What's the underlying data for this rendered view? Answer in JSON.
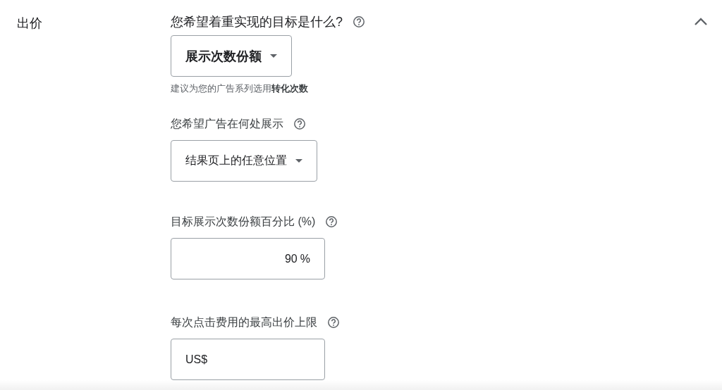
{
  "section": {
    "title": "出价",
    "expanded": true
  },
  "fields": [
    {
      "kind": "dropdown",
      "label": "您希望着重实现的目标是什么?",
      "emphasis": true,
      "value": "展示次数份额",
      "hint": "建议为您的广告系列选用**转化次数**"
    },
    {
      "kind": "dropdown",
      "label": "您希望广告在何处展示",
      "value": "结果页上的任意位置"
    },
    {
      "kind": "input",
      "label": "目标展示次数份额百分比 (%)",
      "value": "90",
      "suffix": "%"
    },
    {
      "kind": "input",
      "label": "每次点击费用的最高出价上限",
      "prefix": "US$"
    }
  ]
}
